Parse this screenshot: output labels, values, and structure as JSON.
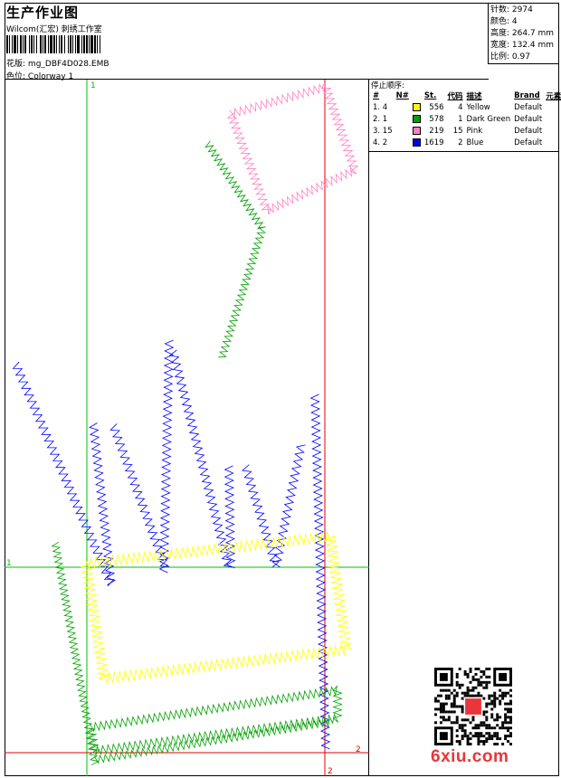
{
  "header": {
    "title": "生产作业图",
    "company": "Wilcom(汇宏) 刺绣工作室",
    "design_label": "花版:",
    "design_name": "mg_DBF4D028.EMB",
    "colorway_label": "色位:",
    "colorway_name": "Colorway 1"
  },
  "stats": {
    "stitches": "针数: 2974",
    "colors": "颜色: 4",
    "height": "高度: 264.7 mm",
    "width": "宽度: 132.4 mm",
    "scale": "比例: 0.97"
  },
  "stop_sequence": {
    "title": "停止顺序:",
    "headers": [
      "#",
      "N#",
      "",
      "St.",
      "代码",
      "描述",
      "Brand",
      "元素"
    ],
    "rows": [
      {
        "seq": "1. 4",
        "n": "",
        "color": "#ffff00",
        "st": "556",
        "code": "4",
        "desc": "Yellow",
        "brand": "Default"
      },
      {
        "seq": "2. 1",
        "n": "",
        "color": "#00a000",
        "st": "578",
        "code": "1",
        "desc": "Dark Green",
        "brand": "Default"
      },
      {
        "seq": "3. 15",
        "n": "",
        "color": "#ff80c0",
        "st": "219",
        "code": "15",
        "desc": "Pink",
        "brand": "Default"
      },
      {
        "seq": "4. 2",
        "n": "",
        "color": "#0000ff",
        "st": "1619",
        "code": "2",
        "desc": "Blue",
        "brand": "Default"
      }
    ]
  },
  "axes": {
    "green_v_label": "1",
    "green_h_label": "1",
    "red_v_label": "2",
    "red_h_label": "2"
  },
  "watermark": "6xiu.com",
  "colors": {
    "yellow": "#ffff00",
    "green": "#00a000",
    "pink": "#ff80c0",
    "blue": "#0000ff",
    "red_line": "#e00000",
    "green_line": "#00c000"
  }
}
